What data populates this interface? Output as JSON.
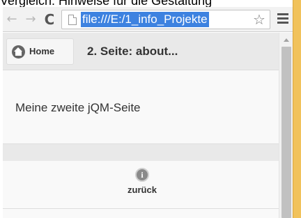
{
  "caption": "Vergleich: Hinweise für die Gestaltung",
  "browser": {
    "back_glyph": "←",
    "forward_glyph": "→",
    "reload_glyph": "C",
    "url": "file:///E:/1_info_Projekte",
    "star_glyph": "☆"
  },
  "page": {
    "header": {
      "home_label": "Home",
      "title": "2. Seite: about..."
    },
    "content_text": "Meine zweite jQM-Seite",
    "footer": {
      "info_glyph": "i",
      "back_label": "zurück"
    }
  }
}
